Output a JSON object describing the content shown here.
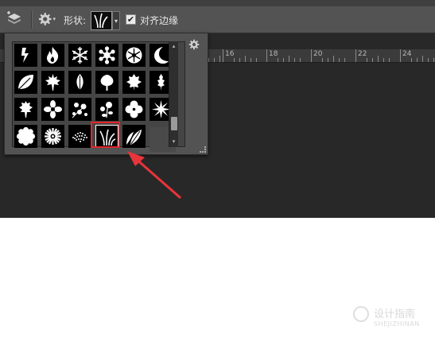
{
  "toolbar": {
    "shape_label": "形状:",
    "align_edges_label": "对齐边缘",
    "align_edges_checked": "✔",
    "dropdown_caret": "▾"
  },
  "ruler": {
    "labels": [
      "16",
      "18",
      "20",
      "22",
      "24"
    ]
  },
  "shape_picker": {
    "shapes": [
      "lightning-shape",
      "fire-shape",
      "snowflake-1-shape",
      "snowflake-2-shape",
      "snowflake-3-shape",
      "moon-shape",
      "leaf-1-shape",
      "maple-leaf-shape",
      "leaf-2-shape",
      "leaf-3-shape",
      "leaf-4-shape",
      "leaf-5-shape",
      "leaf-6-shape",
      "flower-1-shape",
      "flowers-branch-1-shape",
      "flowers-branch-2-shape",
      "flower-2-shape",
      "flower-3-shape",
      "flower-4-shape",
      "flower-5-shape",
      "dots-shape",
      "grass-shape",
      "leaves-shape"
    ],
    "selected": "grass-shape",
    "scroll_up": "▴",
    "scroll_down": "▾"
  },
  "watermark": {
    "text": "设计指南",
    "sub": "SHEJIZHINAN"
  },
  "colors": {
    "toolbar": "#535353",
    "work_area": "#282828",
    "highlight": "#e2242a",
    "arrow": "#e8343b"
  }
}
